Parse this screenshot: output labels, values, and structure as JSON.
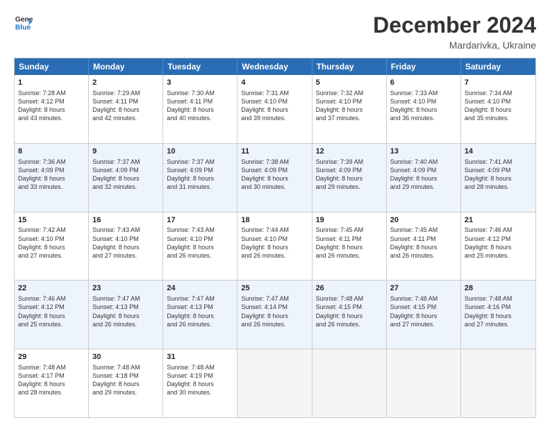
{
  "header": {
    "logo_line1": "General",
    "logo_line2": "Blue",
    "month": "December 2024",
    "location": "Mardarivka, Ukraine"
  },
  "days_of_week": [
    "Sunday",
    "Monday",
    "Tuesday",
    "Wednesday",
    "Thursday",
    "Friday",
    "Saturday"
  ],
  "weeks": [
    [
      {
        "day": "1",
        "lines": [
          "Sunrise: 7:28 AM",
          "Sunset: 4:12 PM",
          "Daylight: 8 hours",
          "and 43 minutes."
        ]
      },
      {
        "day": "2",
        "lines": [
          "Sunrise: 7:29 AM",
          "Sunset: 4:11 PM",
          "Daylight: 8 hours",
          "and 42 minutes."
        ]
      },
      {
        "day": "3",
        "lines": [
          "Sunrise: 7:30 AM",
          "Sunset: 4:11 PM",
          "Daylight: 8 hours",
          "and 40 minutes."
        ]
      },
      {
        "day": "4",
        "lines": [
          "Sunrise: 7:31 AM",
          "Sunset: 4:10 PM",
          "Daylight: 8 hours",
          "and 39 minutes."
        ]
      },
      {
        "day": "5",
        "lines": [
          "Sunrise: 7:32 AM",
          "Sunset: 4:10 PM",
          "Daylight: 8 hours",
          "and 37 minutes."
        ]
      },
      {
        "day": "6",
        "lines": [
          "Sunrise: 7:33 AM",
          "Sunset: 4:10 PM",
          "Daylight: 8 hours",
          "and 36 minutes."
        ]
      },
      {
        "day": "7",
        "lines": [
          "Sunrise: 7:34 AM",
          "Sunset: 4:10 PM",
          "Daylight: 8 hours",
          "and 35 minutes."
        ]
      }
    ],
    [
      {
        "day": "8",
        "lines": [
          "Sunrise: 7:36 AM",
          "Sunset: 4:09 PM",
          "Daylight: 8 hours",
          "and 33 minutes."
        ]
      },
      {
        "day": "9",
        "lines": [
          "Sunrise: 7:37 AM",
          "Sunset: 4:09 PM",
          "Daylight: 8 hours",
          "and 32 minutes."
        ]
      },
      {
        "day": "10",
        "lines": [
          "Sunrise: 7:37 AM",
          "Sunset: 4:09 PM",
          "Daylight: 8 hours",
          "and 31 minutes."
        ]
      },
      {
        "day": "11",
        "lines": [
          "Sunrise: 7:38 AM",
          "Sunset: 4:09 PM",
          "Daylight: 8 hours",
          "and 30 minutes."
        ]
      },
      {
        "day": "12",
        "lines": [
          "Sunrise: 7:39 AM",
          "Sunset: 4:09 PM",
          "Daylight: 8 hours",
          "and 29 minutes."
        ]
      },
      {
        "day": "13",
        "lines": [
          "Sunrise: 7:40 AM",
          "Sunset: 4:09 PM",
          "Daylight: 8 hours",
          "and 29 minutes."
        ]
      },
      {
        "day": "14",
        "lines": [
          "Sunrise: 7:41 AM",
          "Sunset: 4:09 PM",
          "Daylight: 8 hours",
          "and 28 minutes."
        ]
      }
    ],
    [
      {
        "day": "15",
        "lines": [
          "Sunrise: 7:42 AM",
          "Sunset: 4:10 PM",
          "Daylight: 8 hours",
          "and 27 minutes."
        ]
      },
      {
        "day": "16",
        "lines": [
          "Sunrise: 7:43 AM",
          "Sunset: 4:10 PM",
          "Daylight: 8 hours",
          "and 27 minutes."
        ]
      },
      {
        "day": "17",
        "lines": [
          "Sunrise: 7:43 AM",
          "Sunset: 4:10 PM",
          "Daylight: 8 hours",
          "and 26 minutes."
        ]
      },
      {
        "day": "18",
        "lines": [
          "Sunrise: 7:44 AM",
          "Sunset: 4:10 PM",
          "Daylight: 8 hours",
          "and 26 minutes."
        ]
      },
      {
        "day": "19",
        "lines": [
          "Sunrise: 7:45 AM",
          "Sunset: 4:11 PM",
          "Daylight: 8 hours",
          "and 26 minutes."
        ]
      },
      {
        "day": "20",
        "lines": [
          "Sunrise: 7:45 AM",
          "Sunset: 4:11 PM",
          "Daylight: 8 hours",
          "and 26 minutes."
        ]
      },
      {
        "day": "21",
        "lines": [
          "Sunrise: 7:46 AM",
          "Sunset: 4:12 PM",
          "Daylight: 8 hours",
          "and 25 minutes."
        ]
      }
    ],
    [
      {
        "day": "22",
        "lines": [
          "Sunrise: 7:46 AM",
          "Sunset: 4:12 PM",
          "Daylight: 8 hours",
          "and 25 minutes."
        ]
      },
      {
        "day": "23",
        "lines": [
          "Sunrise: 7:47 AM",
          "Sunset: 4:13 PM",
          "Daylight: 8 hours",
          "and 26 minutes."
        ]
      },
      {
        "day": "24",
        "lines": [
          "Sunrise: 7:47 AM",
          "Sunset: 4:13 PM",
          "Daylight: 8 hours",
          "and 26 minutes."
        ]
      },
      {
        "day": "25",
        "lines": [
          "Sunrise: 7:47 AM",
          "Sunset: 4:14 PM",
          "Daylight: 8 hours",
          "and 26 minutes."
        ]
      },
      {
        "day": "26",
        "lines": [
          "Sunrise: 7:48 AM",
          "Sunset: 4:15 PM",
          "Daylight: 8 hours",
          "and 26 minutes."
        ]
      },
      {
        "day": "27",
        "lines": [
          "Sunrise: 7:48 AM",
          "Sunset: 4:15 PM",
          "Daylight: 8 hours",
          "and 27 minutes."
        ]
      },
      {
        "day": "28",
        "lines": [
          "Sunrise: 7:48 AM",
          "Sunset: 4:16 PM",
          "Daylight: 8 hours",
          "and 27 minutes."
        ]
      }
    ],
    [
      {
        "day": "29",
        "lines": [
          "Sunrise: 7:48 AM",
          "Sunset: 4:17 PM",
          "Daylight: 8 hours",
          "and 28 minutes."
        ]
      },
      {
        "day": "30",
        "lines": [
          "Sunrise: 7:48 AM",
          "Sunset: 4:18 PM",
          "Daylight: 8 hours",
          "and 29 minutes."
        ]
      },
      {
        "day": "31",
        "lines": [
          "Sunrise: 7:48 AM",
          "Sunset: 4:19 PM",
          "Daylight: 8 hours",
          "and 30 minutes."
        ]
      },
      {
        "day": "",
        "lines": []
      },
      {
        "day": "",
        "lines": []
      },
      {
        "day": "",
        "lines": []
      },
      {
        "day": "",
        "lines": []
      }
    ]
  ]
}
